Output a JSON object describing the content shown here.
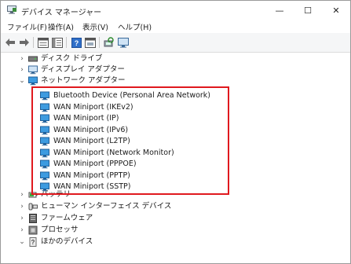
{
  "window": {
    "title": "デバイス マネージャー",
    "controls": {
      "minimize": "—",
      "maximize": "☐",
      "close": "✕"
    }
  },
  "menu": [
    "ファイル(F)",
    "操作(A)",
    "表示(V)",
    "ヘルプ(H)"
  ],
  "toolbar": [
    "back-icon",
    "forward-icon",
    "properties-icon",
    "help-icon",
    "view-icon",
    "scan-icon",
    "monitor-icon"
  ],
  "tree": {
    "categories_before": [
      {
        "label": "ディスク ドライブ",
        "icon": "disk-drive-icon",
        "expanded": false
      },
      {
        "label": "ディスプレイ アダプター",
        "icon": "display-adapter-icon",
        "expanded": false
      },
      {
        "label": "ネットワーク アダプター",
        "icon": "network-adapter-icon",
        "expanded": true
      }
    ],
    "network_adapters": [
      "Bluetooth Device (Personal Area Network)",
      "WAN Miniport (IKEv2)",
      "WAN Miniport (IP)",
      "WAN Miniport (IPv6)",
      "WAN Miniport (L2TP)",
      "WAN Miniport (Network Monitor)",
      "WAN Miniport (PPPOE)",
      "WAN Miniport (PPTP)",
      "WAN Miniport (SSTP)"
    ],
    "categories_after": [
      {
        "label": "バッテリ",
        "icon": "battery-icon",
        "expanded": false
      },
      {
        "label": "ヒューマン インターフェイス デバイス",
        "icon": "hid-icon",
        "expanded": false
      },
      {
        "label": "ファームウェア",
        "icon": "firmware-icon",
        "expanded": false
      },
      {
        "label": "プロセッサ",
        "icon": "processor-icon",
        "expanded": false
      },
      {
        "label": "ほかのデバイス",
        "icon": "other-device-icon",
        "expanded": false
      }
    ]
  },
  "colors": {
    "highlight_border": "#e0191e",
    "network_icon": "#2a8fd6"
  }
}
